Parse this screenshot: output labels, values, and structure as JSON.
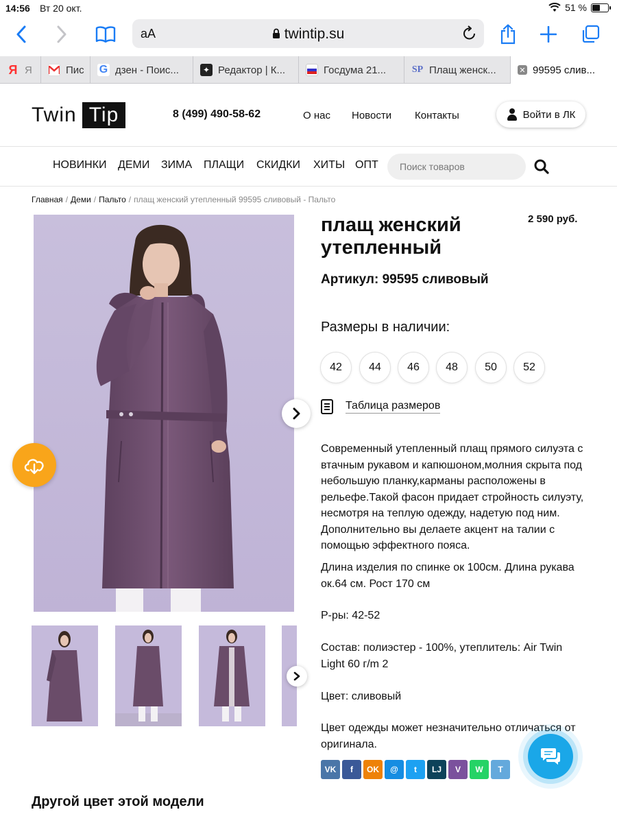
{
  "status_bar": {
    "time": "14:56",
    "date": "Вт 20 окт.",
    "battery": "51 %",
    "battery_fraction": 0.51
  },
  "browser": {
    "text_size_label": "aA",
    "url": "twintip.su",
    "tabs": [
      {
        "label": "Я",
        "favicon": "yandex-icon"
      },
      {
        "label": "Пис",
        "favicon": "gmail-icon"
      },
      {
        "label": "дзен - Поис...",
        "favicon": "google-icon"
      },
      {
        "label": "Редактор | К...",
        "favicon": "zen-icon"
      },
      {
        "label": "Госдума 21...",
        "favicon": "gosduma-icon"
      },
      {
        "label": "Плащ женск...",
        "favicon": "sp-icon"
      },
      {
        "label": "99595 слив...",
        "favicon": "close-icon",
        "active": true
      }
    ]
  },
  "header": {
    "logo_twin": "Twin",
    "logo_tip": "Tip",
    "phone": "8 (499) 490-58-62",
    "nav": [
      "О нас",
      "Новости",
      "Контакты"
    ],
    "login": "Войти в ЛК"
  },
  "categories": [
    "НОВИНКИ",
    "ДЕМИ",
    "ЗИМА",
    "ПЛАЩИ",
    "СКИДКИ",
    "ХИТЫ",
    "ОПТ"
  ],
  "search": {
    "placeholder": "Поиск товаров"
  },
  "breadcrumb": {
    "items": [
      "Главная",
      "Деми",
      "Пальто"
    ],
    "current": "плащ женский утепленный 99595 сливовый - Пальто"
  },
  "product": {
    "title": "плащ женский утепленный",
    "price": "2 590 руб.",
    "sku": "Артикул: 99595 сливовый",
    "sizes_label": "Размеры в наличии:",
    "sizes": [
      "42",
      "44",
      "46",
      "48",
      "50",
      "52"
    ],
    "size_table": "Таблица размеров",
    "description": [
      "Современный утепленный плащ прямого силуэта с втачным рукавом и капюшоном,молния скрыта под небольшую планку,карманы расположены в рельефе.Такой фасон придает стройность силуэту, несмотря на теплую одежду, надетую под ним. Дополнительно вы делаете акцент на талии с помощью эффектного пояса.",
      "Длина изделия по спинке ок 100см. Длина рукава  ок.64 см. Рост 170 см",
      "Р-ры: 42-52",
      "Состав: полиэстер - 100%, утеплитель: Air Twin Light 60 г/m 2",
      "Цвет: сливовый",
      "Цвет одежды может незначительно отличаться от оригинала."
    ],
    "share": [
      {
        "name": "vk-icon",
        "label": "VK",
        "color": "#4a76a8"
      },
      {
        "name": "facebook-icon",
        "label": "f",
        "color": "#3b5998"
      },
      {
        "name": "odnoklassniki-icon",
        "label": "OK",
        "color": "#ee8208"
      },
      {
        "name": "moimir-icon",
        "label": "@",
        "color": "#168de2"
      },
      {
        "name": "twitter-icon",
        "label": "t",
        "color": "#1da1f2"
      },
      {
        "name": "livejournal-icon",
        "label": "LJ",
        "color": "#0d425a"
      },
      {
        "name": "viber-icon",
        "label": "V",
        "color": "#7b519d"
      },
      {
        "name": "whatsapp-icon",
        "label": "W",
        "color": "#25d366"
      },
      {
        "name": "telegram-icon",
        "label": "T",
        "color": "#64a9dc"
      }
    ]
  },
  "other_color_heading": "Другой цвет этой модели",
  "colors": {
    "accent_blue": "#1a7cf5",
    "coat_plum": "#6e4e6c",
    "backdrop_lilac": "#c6bbdb",
    "cloud_orange": "#f9a51a",
    "chat_blue": "#1aa7e8"
  }
}
